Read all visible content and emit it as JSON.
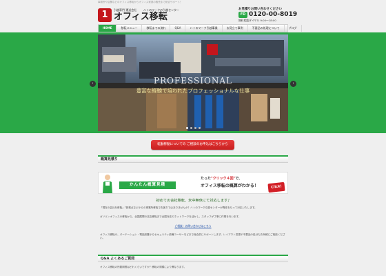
{
  "header": {
    "top_note": "事務所や店舗などのオフィス移転からオフィス家具の販売まで総合サポート！",
    "logo_mark": "1",
    "logo_sub": "引越専門 運送会社",
    "logo_tag": "ハトのマークの引越センター",
    "logo_title": "オフィス移転",
    "contact_label": "お見積りお問い合わせください",
    "freedial": "FD",
    "phone": "0120-00-8019",
    "hours": "無料相談ダイヤル 9:00～18:00"
  },
  "nav": {
    "items": [
      "HOME",
      "移転メニュー",
      "移転までの流れ",
      "Q&A",
      "ハトのマーク引越事業",
      "お見立て事例",
      "不要品の処理について",
      "ブログ"
    ]
  },
  "slider": {
    "caption_main": "PROFESSIONAL",
    "caption_sub": "豊富な経験で培われたプロフェッショナルな仕事",
    "dot_count": 4,
    "active_dot": 1,
    "prev": "‹",
    "next": "›"
  },
  "cta": {
    "label": "転勤移動についての ご相談のお申込はこちらから"
  },
  "section1": {
    "title": "概算見積り"
  },
  "banner": {
    "label": "かんたん概算見積",
    "line1_prefix": "たった",
    "line1_emph": "\"クリック４回\"",
    "line1_suffix": "で、",
    "line2": "オフィス移転の概算がわかる！",
    "click": "Click!"
  },
  "intro": {
    "lead": "初めての会社移転、未中無休にて対応します♪",
    "p1": "「現在の会社を移転」「新拠点などからの事業所移転でお困りではありませんか？ハトのマーク引越センターが責任をもって対応いたします。",
    "p2": "ガソリンオフィスの移転から、全国展開の支店移転まで全国対応のネットワークを活かし、スタッフが丁寧に作業を行います。",
    "link": "ご相談・お問い合わせはこちら",
    "p3": "オフィス移転の、パーテーション・電話設置からセキュリティ設備ユーザーなどまで総合的にサポートします。レイアウト変更や不要品の処分もお気軽にご相談ください。"
  },
  "section2": {
    "title": "Q&A よくあるご質問",
    "text": "オフィス移転の所要期間はどれくらいですか？移転の規模により異なります。"
  },
  "colors": {
    "brand_green": "#2aa847",
    "cta_red": "#d21f26"
  }
}
